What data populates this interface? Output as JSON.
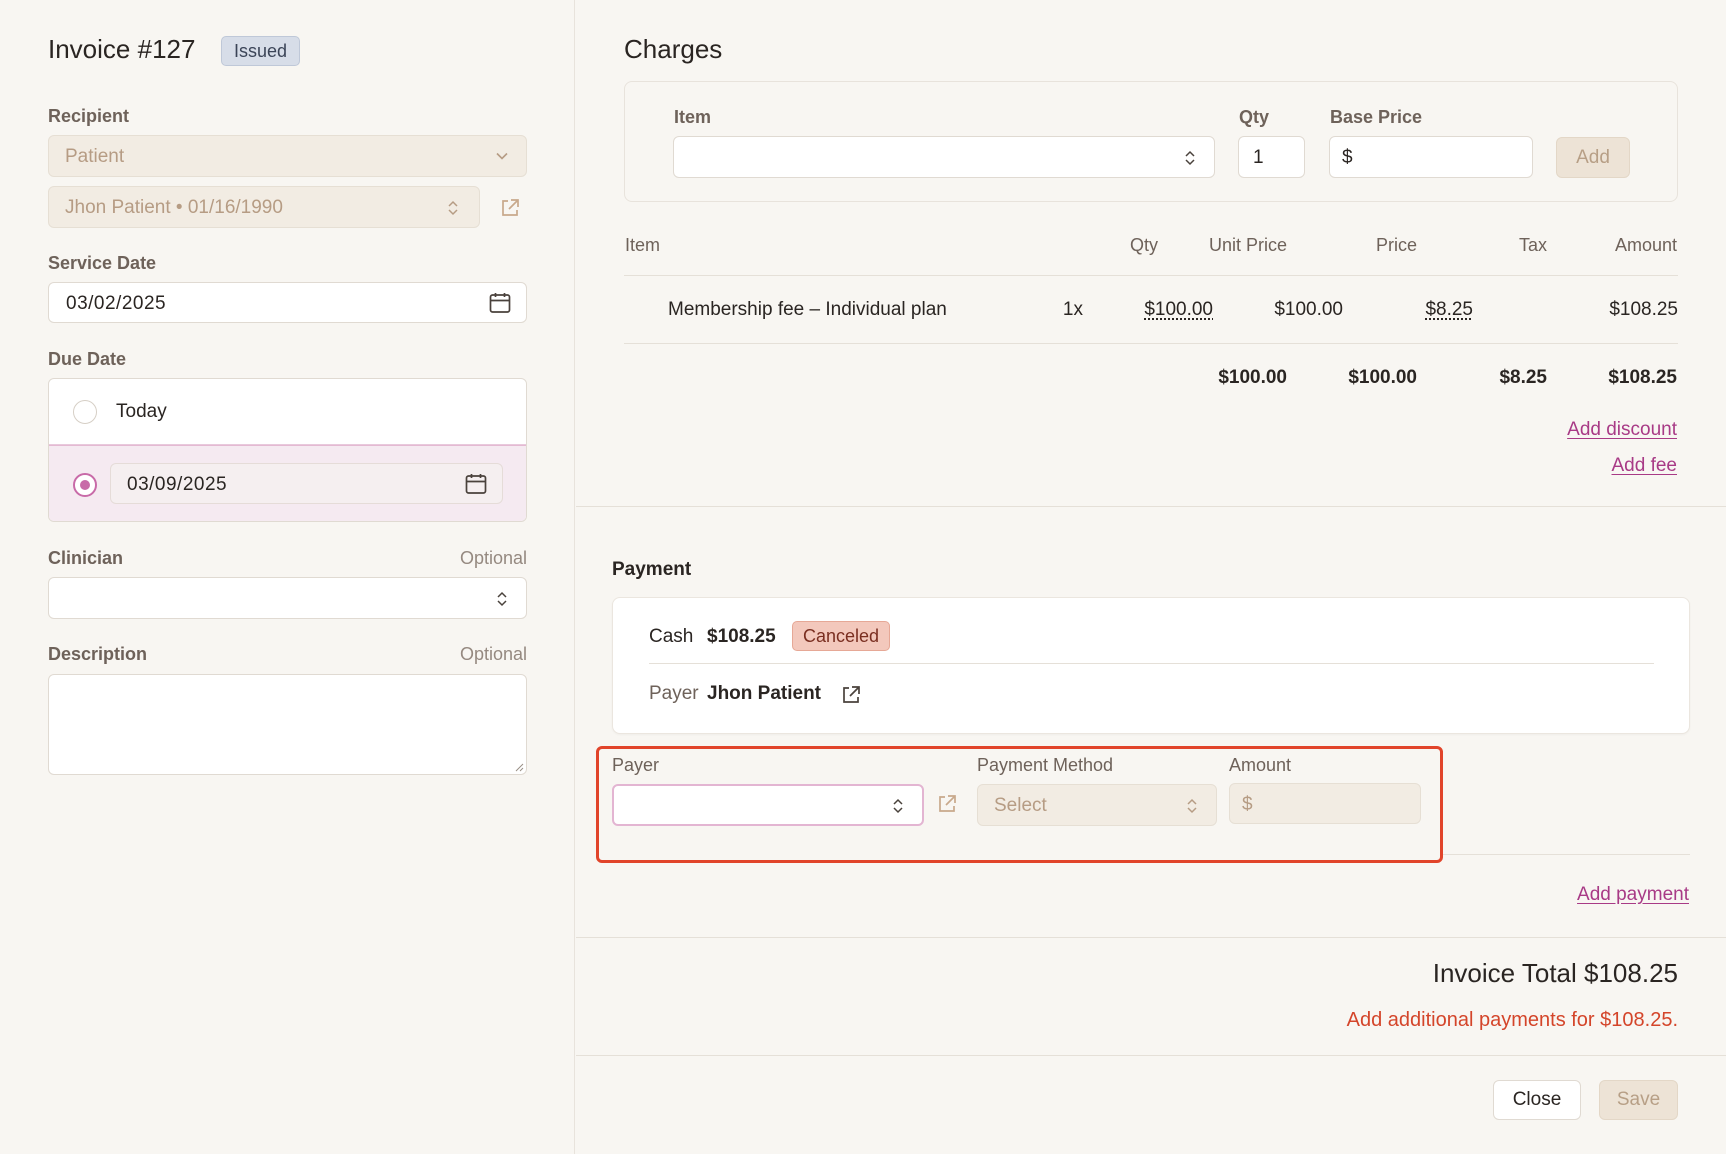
{
  "invoice": {
    "title": "Invoice #127",
    "status": "Issued"
  },
  "left": {
    "recipient_label": "Recipient",
    "recipient_type": "Patient",
    "recipient_patient": "Jhon Patient • 01/16/1990",
    "service_date_label": "Service Date",
    "service_date": "03/02/2025",
    "due_date_label": "Due Date",
    "due_today_label": "Today",
    "due_custom_date": "03/09/2025",
    "clinician_label": "Clinician",
    "clinician_optional": "Optional",
    "description_label": "Description",
    "description_optional": "Optional"
  },
  "charges": {
    "title": "Charges",
    "form": {
      "item_label": "Item",
      "qty_label": "Qty",
      "qty_value": "1",
      "base_price_label": "Base Price",
      "base_price_prefix": "$",
      "add_button": "Add"
    },
    "table": {
      "headers": {
        "item": "Item",
        "qty": "Qty",
        "unit_price": "Unit Price",
        "price": "Price",
        "tax": "Tax",
        "amount": "Amount"
      },
      "rows": [
        {
          "item": "Membership fee – Individual plan",
          "qty": "1x",
          "unit_price": "$100.00",
          "price": "$100.00",
          "tax": "$8.25",
          "amount": "$108.25"
        }
      ],
      "totals": {
        "unit_price": "$100.00",
        "price": "$100.00",
        "tax": "$8.25",
        "amount": "$108.25"
      }
    },
    "add_discount": "Add discount",
    "add_fee": "Add fee"
  },
  "payment": {
    "title": "Payment",
    "existing": {
      "method": "Cash",
      "amount": "$108.25",
      "status": "Canceled",
      "payer_label": "Payer",
      "payer_name": "Jhon Patient"
    },
    "new": {
      "payer_label": "Payer",
      "method_label": "Payment Method",
      "method_placeholder": "Select",
      "amount_label": "Amount",
      "amount_prefix": "$"
    },
    "add_payment": "Add payment"
  },
  "summary": {
    "invoice_total": "Invoice Total $108.25",
    "warning": "Add additional payments for $108.25."
  },
  "footer": {
    "close": "Close",
    "save": "Save"
  },
  "colors": {
    "accent": "#c86aa8",
    "link": "#a83a86",
    "warning": "#d4452a",
    "highlight": "#e1442a"
  }
}
